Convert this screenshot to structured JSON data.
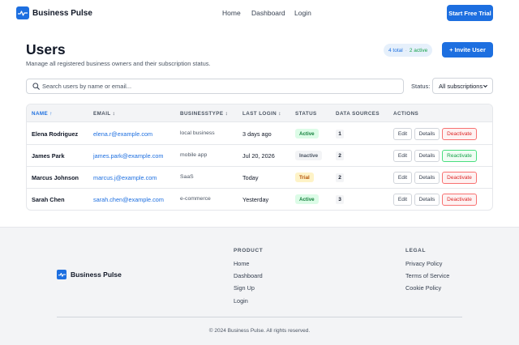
{
  "header": {
    "brand": "Business Pulse",
    "nav": [
      "Home",
      "Dashboard",
      "Login"
    ],
    "cta_label": "Start Free Trial"
  },
  "page": {
    "title": "Users",
    "subtitle": "Manage all registered business owners and their subscription status.",
    "badge_total": "4 total",
    "badge_sep": "·",
    "badge_active": "2 active",
    "invite_label": "+ Invite User"
  },
  "filters": {
    "search_placeholder": "Search users by name or email...",
    "status_label": "Status:",
    "status_value": "All subscriptions"
  },
  "table": {
    "columns": [
      "NAME ↑",
      "EMAIL ↕",
      "BUSINESSTYPE ↕",
      "LAST LOGIN ↕",
      "STATUS",
      "DATA SOURCES",
      "ACTIONS"
    ],
    "rows": [
      {
        "name": "Elena Rodriguez",
        "email": "elena.r@example.com",
        "type": "local business",
        "last_login": "3 days ago",
        "status": "Active",
        "data_sources": "1",
        "edit": "Edit",
        "details": "Details",
        "toggle": "Deactivate"
      },
      {
        "name": "James Park",
        "email": "james.park@example.com",
        "type": "mobile app",
        "last_login": "Jul 20, 2026",
        "status": "Inactive",
        "data_sources": "2",
        "edit": "Edit",
        "details": "Details",
        "toggle": "Reactivate"
      },
      {
        "name": "Marcus Johnson",
        "email": "marcus.j@example.com",
        "type": "SaaS",
        "last_login": "Today",
        "status": "Trial",
        "data_sources": "2",
        "edit": "Edit",
        "details": "Details",
        "toggle": "Deactivate"
      },
      {
        "name": "Sarah Chen",
        "email": "sarah.chen@example.com",
        "type": "e-commerce",
        "last_login": "Yesterday",
        "status": "Active",
        "data_sources": "3",
        "edit": "Edit",
        "details": "Details",
        "toggle": "Deactivate"
      }
    ]
  },
  "footer": {
    "brand": "Business Pulse",
    "product_heading": "PRODUCT",
    "product_links": [
      "Home",
      "Dashboard",
      "Sign Up",
      "Login"
    ],
    "legal_heading": "LEGAL",
    "legal_links": [
      "Privacy Policy",
      "Terms of Service",
      "Cookie Policy"
    ],
    "copyright": "© 2024 Business Pulse. All rights reserved."
  },
  "colors": {
    "accent": "#1d6fe0",
    "active": "#15803d",
    "trial": "#b45309",
    "danger": "#dc2626"
  }
}
